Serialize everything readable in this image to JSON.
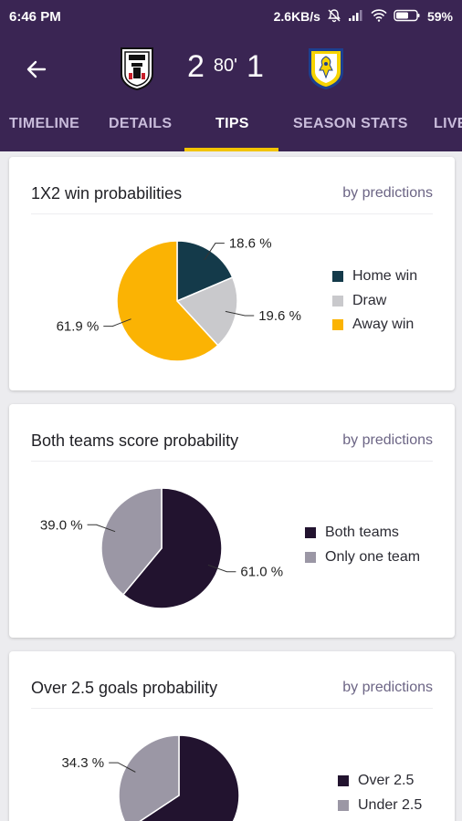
{
  "status_bar": {
    "time": "6:46 PM",
    "network_speed": "2.6KB/s",
    "battery": "59%",
    "icons": [
      "mute-icon",
      "signal-icon",
      "wifi-icon",
      "battery-icon"
    ]
  },
  "match": {
    "home_score": "2",
    "minute": "80'",
    "away_score": "1",
    "home_crest": "fulham-crest-icon",
    "away_crest": "leeds-crest-icon"
  },
  "tabs": [
    {
      "label": "TIMELINE",
      "active": false
    },
    {
      "label": "DETAILS",
      "active": false
    },
    {
      "label": "TIPS",
      "active": true
    },
    {
      "label": "SEASON STATS",
      "active": false
    },
    {
      "label": "LIVE",
      "active": false
    }
  ],
  "colors": {
    "header": "#3a2553",
    "accent": "#f2c400",
    "home_win": "#143a4a",
    "draw": "#c9c9cc",
    "away_win": "#fbb303",
    "both_teams": "#22132f",
    "only_one_team": "#9b97a5",
    "over": "#22132f",
    "under": "#9b97a5"
  },
  "cards": [
    {
      "title": "1X2 win probabilities",
      "link": "by predictions",
      "chart_data": {
        "type": "pie",
        "title": "1X2 win probabilities",
        "slices": [
          {
            "name": "Home win",
            "value": 18.6,
            "label": "18.6 %"
          },
          {
            "name": "Draw",
            "value": 19.6,
            "label": "19.6 %"
          },
          {
            "name": "Away win",
            "value": 61.9,
            "label": "61.9 %"
          }
        ],
        "legend_position": "right"
      }
    },
    {
      "title": "Both teams score probability",
      "link": "by predictions",
      "chart_data": {
        "type": "pie",
        "title": "Both teams score probability",
        "slices": [
          {
            "name": "Both teams",
            "value": 61.0,
            "label": "61.0 %"
          },
          {
            "name": "Only one team",
            "value": 39.0,
            "label": "39.0 %"
          }
        ],
        "legend_position": "right"
      }
    },
    {
      "title": "Over 2.5 goals probability",
      "link": "by predictions",
      "chart_data": {
        "type": "pie",
        "title": "Over 2.5 goals probability",
        "slices": [
          {
            "name": "Over 2.5",
            "value": 65.7,
            "label": ""
          },
          {
            "name": "Under 2.5",
            "value": 34.3,
            "label": "34.3 %"
          }
        ],
        "legend_position": "right"
      }
    }
  ]
}
